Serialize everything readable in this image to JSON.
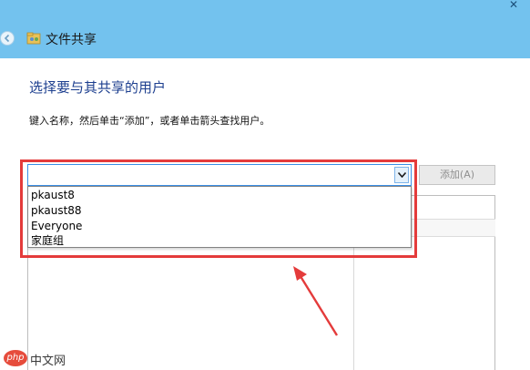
{
  "window": {
    "title": "文件共享",
    "close_glyph": "✕"
  },
  "content": {
    "heading": "选择要与其共享的用户",
    "instruction": "键入名称，然后单击“添加”，或者单击箭头查找用户。"
  },
  "user_combo": {
    "value": "",
    "options": [
      "pkaust8",
      "pkaust88",
      "Everyone",
      "家庭组"
    ]
  },
  "add_button": {
    "label": "添加(A)"
  },
  "watermark": {
    "logo": "php",
    "text": "中文网"
  },
  "colors": {
    "titlebar": "#73c2ee",
    "heading": "#1d3f8f",
    "highlight": "#e43b3b",
    "focus_border": "#3a8ee6"
  }
}
